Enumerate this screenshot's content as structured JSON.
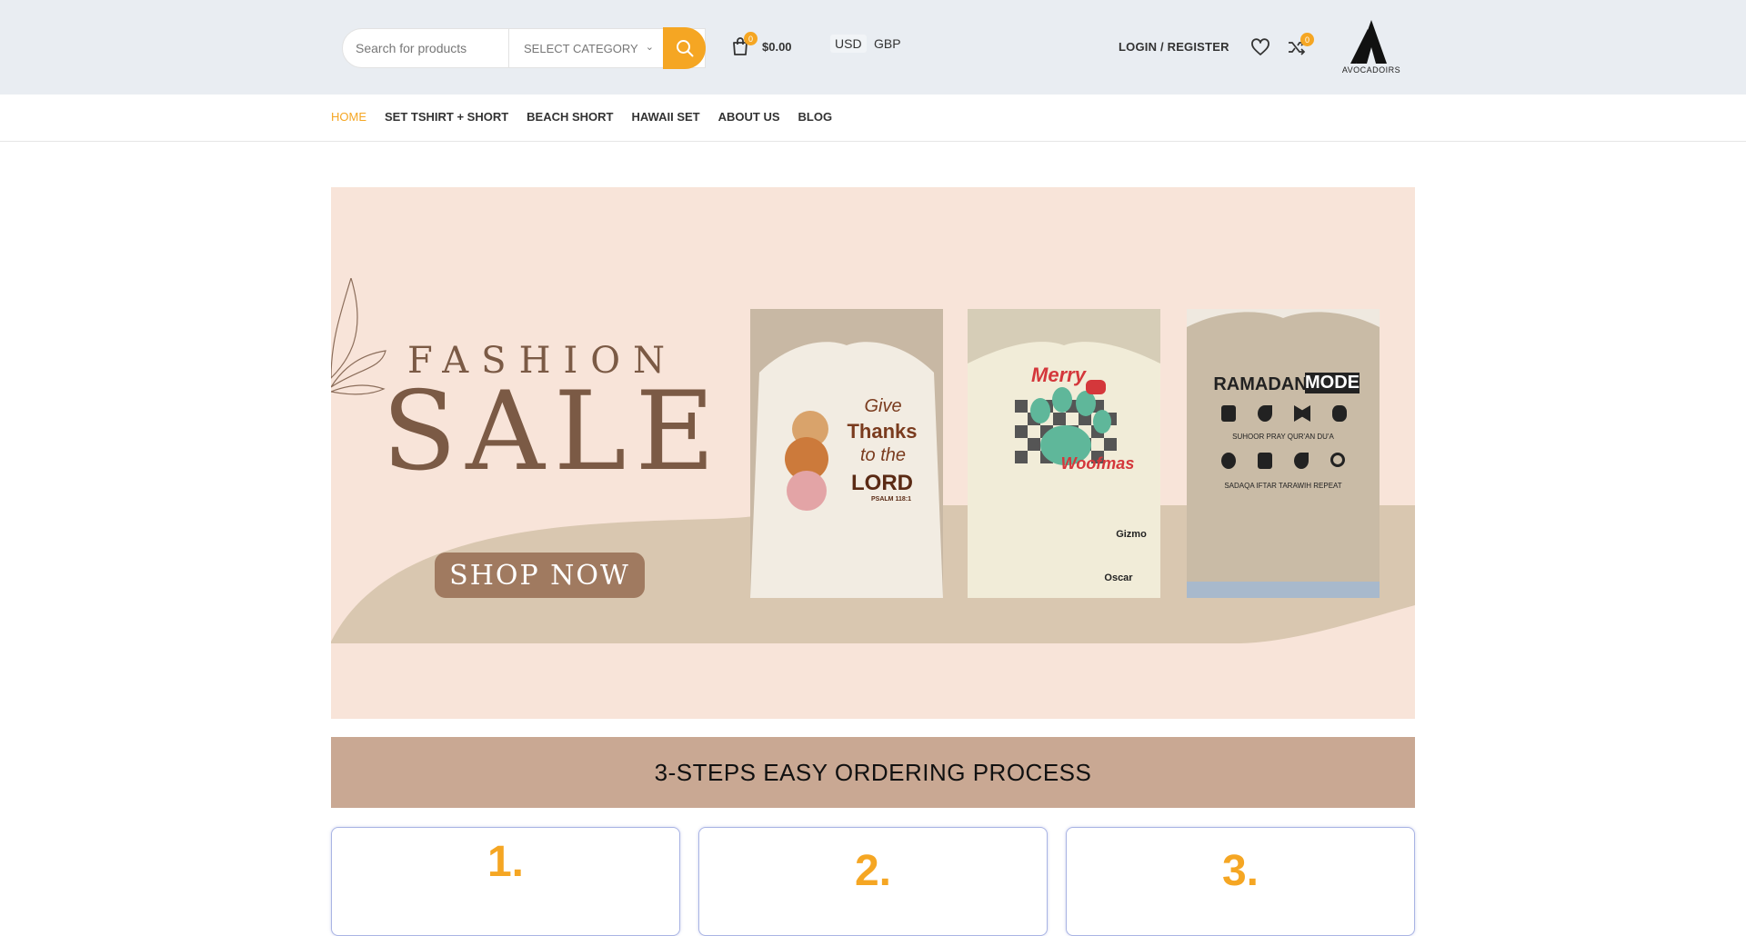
{
  "header": {
    "search_placeholder": "Search for products",
    "category_label": "SELECT CATEGORY",
    "cart_count": "0",
    "cart_amount": "$0.00",
    "currency_usd": "USD",
    "currency_gbp": "GBP",
    "login_label": "LOGIN / REGISTER",
    "compare_count": "0",
    "logo_text": "AVOCADOIRS",
    "accent_color": "#f5a623"
  },
  "nav": {
    "items": [
      {
        "label": "HOME",
        "active": true
      },
      {
        "label": "SET TSHIRT + SHORT",
        "active": false
      },
      {
        "label": "BEACH SHORT",
        "active": false
      },
      {
        "label": "HAWAII SET",
        "active": false
      },
      {
        "label": "ABOUT US",
        "active": false
      },
      {
        "label": "BLOG",
        "active": false
      }
    ]
  },
  "banner": {
    "line1": "FASHION",
    "line2": "SALE",
    "button": "SHOP NOW",
    "products": [
      {
        "text1": "Give",
        "text2": "Thanks",
        "text3": "to the",
        "text4": "LORD",
        "text5": "PSALM 118:1"
      },
      {
        "text1": "Merry",
        "text2": "Woofmas",
        "text3": "Gizmo",
        "text4": "Oscar"
      },
      {
        "text1": "RAMADAN",
        "text2": "MODE",
        "text3": "SUHOOR  PRAY  QUR'AN  DU'A",
        "text4": "SADAQA  IFTAR  TARAWIH  REPEAT"
      }
    ]
  },
  "steps": {
    "title": "3-STEPS EASY ORDERING PROCESS",
    "numbers": [
      "1.",
      "2.",
      "3."
    ]
  }
}
